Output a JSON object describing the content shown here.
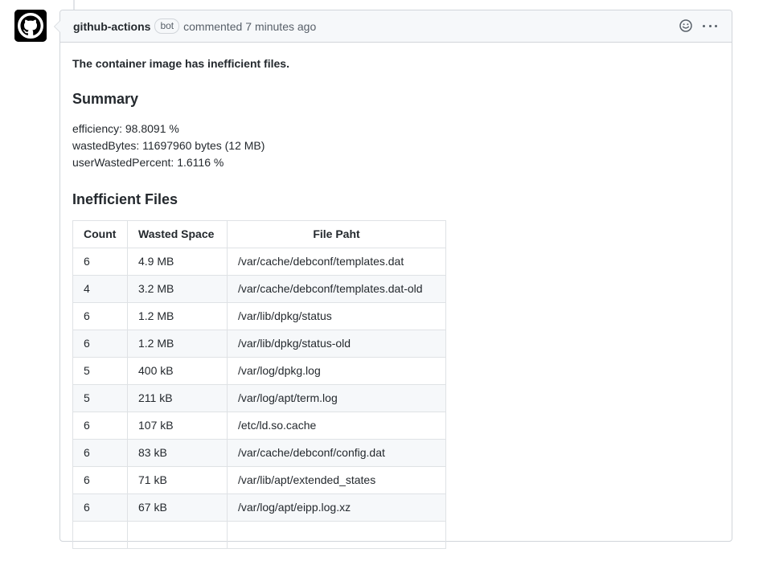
{
  "comment": {
    "author": "github-actions",
    "badge": "bot",
    "action": "commented",
    "timestamp": "7 minutes ago"
  },
  "body": {
    "intro": "The container image has inefficient files.",
    "summary_title": "Summary",
    "metrics": [
      "efficiency: 98.8091 %",
      "wastedBytes: 11697960 bytes (12 MB)",
      "userWastedPercent: 1.6116 %"
    ],
    "files_title": "Inefficient Files",
    "table": {
      "headers": [
        "Count",
        "Wasted Space",
        "File Paht"
      ],
      "rows": [
        [
          "6",
          "4.9 MB",
          "/var/cache/debconf/templates.dat"
        ],
        [
          "4",
          "3.2 MB",
          "/var/cache/debconf/templates.dat-old"
        ],
        [
          "6",
          "1.2 MB",
          "/var/lib/dpkg/status"
        ],
        [
          "6",
          "1.2 MB",
          "/var/lib/dpkg/status-old"
        ],
        [
          "5",
          "400 kB",
          "/var/log/dpkg.log"
        ],
        [
          "5",
          "211 kB",
          "/var/log/apt/term.log"
        ],
        [
          "6",
          "107 kB",
          "/etc/ld.so.cache"
        ],
        [
          "6",
          "83 kB",
          "/var/cache/debconf/config.dat"
        ],
        [
          "6",
          "71 kB",
          "/var/lib/apt/extended_states"
        ],
        [
          "6",
          "67 kB",
          "/var/log/apt/eipp.log.xz"
        ],
        [
          "",
          "",
          ""
        ]
      ]
    }
  },
  "icons": {
    "avatar": "github-octocat-icon",
    "reaction": "smiley-icon",
    "menu": "kebab-horizontal-icon"
  },
  "colors": {
    "header_bg": "#f6f8fa",
    "border": "#d1d5da",
    "text": "#24292e",
    "muted": "#586069"
  }
}
